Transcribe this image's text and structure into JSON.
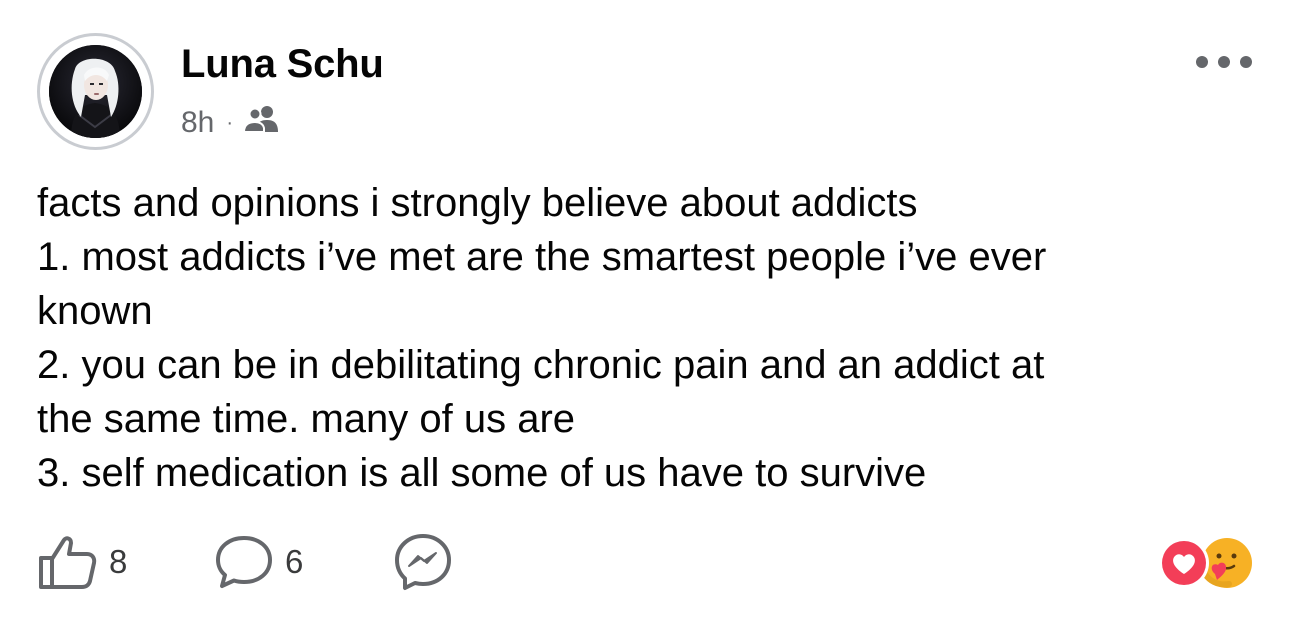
{
  "post": {
    "author": "Luna Schu",
    "time": "8h",
    "separator": "·",
    "audience_icon": "friends-icon",
    "text_lines": [
      "facts and opinions i strongly believe about addicts",
      "1. most addicts i’ve met are the smartest people i’ve ever",
      "known",
      "2. you can be in debilitating chronic pain and an addict at",
      "the same time. many of us are",
      "3. self medication is all some of us have to survive"
    ]
  },
  "actions": {
    "like_count": "8",
    "comment_count": "6",
    "like_icon": "thumbs-up-icon",
    "comment_icon": "comment-bubble-icon",
    "share_icon": "messenger-icon"
  },
  "reactions": {
    "types": [
      "love",
      "care"
    ],
    "colors": {
      "love": "#f33e58",
      "care": "#f7b125"
    }
  },
  "colors": {
    "text_primary": "#050505",
    "text_secondary": "#65676b",
    "icon": "#65676b"
  }
}
